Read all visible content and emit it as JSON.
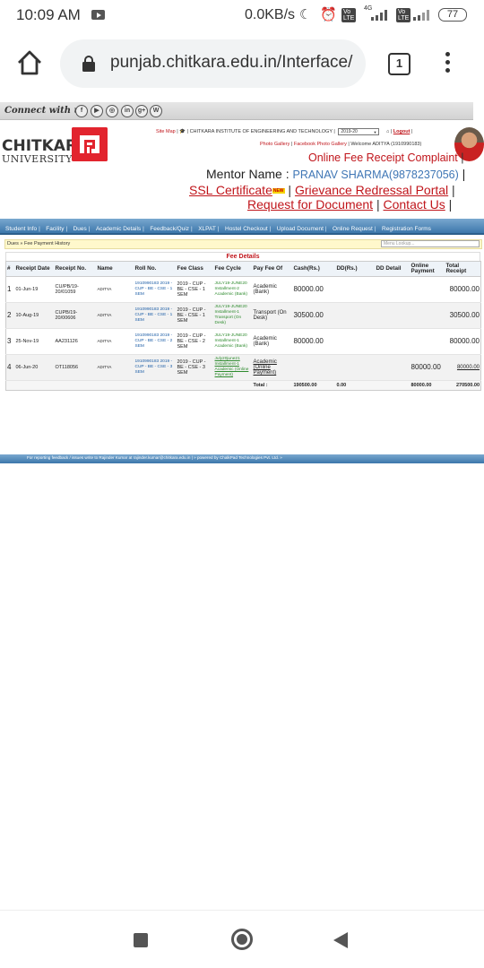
{
  "status_bar": {
    "time": "10:09 AM",
    "speed": "0.0KB/s",
    "network": "4G",
    "volte": "Vo LTE",
    "battery": "77"
  },
  "browser": {
    "url": "punjab.chitkara.edu.in/Interface/",
    "tab_count": "1",
    "icons": [
      "home-icon",
      "lock-icon",
      "tabs-icon",
      "menu-icon"
    ]
  },
  "connect": {
    "label": "Connect with us",
    "social": [
      "f",
      "▶",
      "◎",
      "in",
      "g+",
      "W"
    ]
  },
  "logo": {
    "name": "CHITKARA",
    "subtitle": "UNIVERSITY"
  },
  "header": {
    "site_map": "Site Map",
    "institute": "CHITKARA INSTITUTE OF ENGINEERING AND TECHNOLOGY",
    "year": "2019-20",
    "logout": "Logout",
    "photo_gallery": "Photo Gallery",
    "fb_gallery": "Facebook Photo Gallery",
    "welcome": "Welcome ADITYA (1910990183)",
    "complaint_link": "Online Fee Receipt Complaint",
    "mentor_label": "Mentor Name :",
    "mentor_value": "PRANAV SHARMA(9878237056)",
    "ssl": "SSL Certificate",
    "new_badge": "NEW",
    "grievance": "Grievance Redressal Portal",
    "request_doc": "Request for Document",
    "contact": "Contact Us"
  },
  "nav": {
    "items": [
      "Student Info",
      "Facility",
      "Dues",
      "Academic Details",
      "Feedback/Quiz",
      "XLPAT",
      "Hostel Checkout",
      "Upload Document",
      "Online Request",
      "Registration Forms"
    ]
  },
  "breadcrumb": {
    "text": "Dues » Fee Payment History",
    "lookup_placeholder": "Menu Lookup..."
  },
  "fee": {
    "title": "Fee Details",
    "columns": [
      "#",
      "Receipt Date",
      "Receipt No.",
      "Name",
      "Roll No.",
      "Fee Class",
      "Fee Cycle",
      "Pay Fee Of",
      "Cash(Rs.)",
      "DD(Rs.)",
      "DD Detail",
      "Online Payment",
      "Total Receipt"
    ],
    "rows": [
      {
        "idx": "1",
        "date": "01-Jun-19",
        "receipt": "CU/PB/19-20/01059",
        "name": "ADITYA",
        "roll": "1910990183 2019 - CUP - BE - CSE - 1 SEM",
        "fee_class": "2019 - CUP - BE - CSE - 1 SEM",
        "cycle": "JULY19-JUNE20 Installment-2 Academic (Bank)",
        "pay_of": "Academic (Bank)",
        "cash": "80000.00",
        "dd": "",
        "dd_detail": "",
        "online": "",
        "total": "80000.00"
      },
      {
        "idx": "2",
        "date": "10-Aug-19",
        "receipt": "CUPB/19-20/00606",
        "name": "ADITYA",
        "roll": "1910990183 2019 - CUP - BE - CSE - 1 SEM",
        "fee_class": "2019 - CUP - BE - CSE - 1 SEM",
        "cycle": "JULY19-JUNE20 Installment-1 Transport (On Desk)",
        "pay_of": "Transport (On Desk)",
        "cash": "30500.00",
        "dd": "",
        "dd_detail": "",
        "online": "",
        "total": "30500.00"
      },
      {
        "idx": "3",
        "date": "25-Nov-19",
        "receipt": "AA231126",
        "name": "ADITYA",
        "roll": "1910990183 2019 - CUP - BE - CSE - 2 SEM",
        "fee_class": "2019 - CUP - BE - CSE - 2 SEM",
        "cycle": "JULY19-JUNE20 Installment-1 Academic (Bank)",
        "pay_of": "Academic (Bank)",
        "cash": "80000.00",
        "dd": "",
        "dd_detail": "",
        "online": "",
        "total": "80000.00"
      },
      {
        "idx": "4",
        "date": "06-Jun-20",
        "receipt": "OT118056",
        "name": "ADITYA",
        "roll": "1910990183 2019 - CUP - BE - CSE - 3 SEM",
        "fee_class": "2019 - CUP - BE - CSE - 3 SEM",
        "cycle": "July20june21 Installment-1 Academic (Online Payment)",
        "pay_of": "Academic (Online Payment)",
        "cash": "",
        "dd": "",
        "dd_detail": "",
        "online": "80000.00",
        "total": "80000.00"
      }
    ],
    "total_label": "Total :",
    "total_cash": "190500.00",
    "total_dd": "0.00",
    "total_online": "80000.00",
    "total_receipt": "270500.00"
  },
  "footer": {
    "text": "For reporting feedback / issues write to Rajinder Kumar at rajinder.kumar@chitkara.edu.in | » powered by ChalkPad Technologies Pvt. Ltd. »"
  },
  "colors": {
    "accent_red": "#c0151b",
    "link_blue": "#3f76b5",
    "nav_blue": "#3c77ab",
    "green_text": "#2e8b2e"
  }
}
